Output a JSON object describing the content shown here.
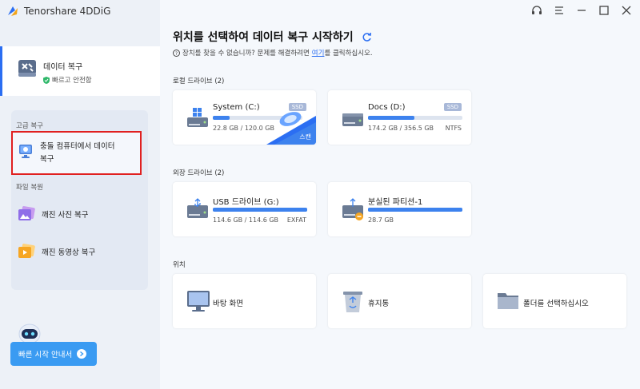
{
  "app": {
    "name": "Tenorshare 4DDiG"
  },
  "sidebar": {
    "data_recovery": {
      "label": "데이터 복구",
      "sub": "빠르고 안전함"
    },
    "advanced_label": "고급 복구",
    "crash_recovery": {
      "label_line1": "충돌 컴퓨터에서 데이터",
      "label_line2": "복구"
    },
    "file_repair_label": "파일 복원",
    "photo_repair": "깨진 사진 복구",
    "video_repair": "깨진 동영상 복구",
    "quick_start": "빠른 시작 안내서"
  },
  "main": {
    "title": "위치를 선택하여 데이터 복구 시작하기",
    "help_prefix": "장치를 찾을 수 없습니까? 문제를 해결하려면",
    "help_link": "여기",
    "help_suffix": "를 클릭하십시오.",
    "local_label": "로컬 드라이브 (2)",
    "external_label": "외장 드라이브 (2)",
    "location_label": "위치"
  },
  "local_drives": [
    {
      "name": "System (C:)",
      "size": "22.8 GB / 120.0 GB",
      "fs": "",
      "badge": "SSD",
      "used_fraction": 0.19,
      "scan_label": "스캔"
    },
    {
      "name": "Docs (D:)",
      "size": "174.2 GB / 356.5 GB",
      "fs": "NTFS",
      "badge": "SSD",
      "used_fraction": 0.49
    }
  ],
  "external_drives": [
    {
      "name": "USB 드라이브 (G:)",
      "size": "114.6 GB / 114.6 GB",
      "fs": "EXFAT",
      "used_fraction": 1.0
    },
    {
      "name": "분실된 파티션-1",
      "size": "28.7 GB",
      "fs": "",
      "used_fraction": 1.0
    }
  ],
  "locations": [
    {
      "name": "바탕 화면",
      "icon": "monitor-icon"
    },
    {
      "name": "휴지통",
      "icon": "recycle-bin-icon"
    },
    {
      "name": "폴더를 선택하십시오",
      "icon": "folder-icon"
    }
  ],
  "colors": {
    "accent": "#2b6ef2",
    "bar": "#3d82ee",
    "quick_button": "#3a9bf2",
    "selection_border": "#e02020"
  }
}
